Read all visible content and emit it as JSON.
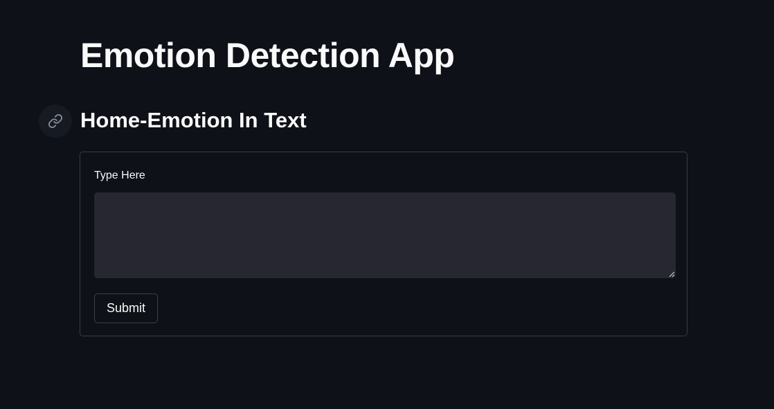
{
  "app": {
    "title": "Emotion Detection App"
  },
  "section": {
    "title": "Home-Emotion In Text",
    "anchor_icon": "link-icon"
  },
  "form": {
    "text_area": {
      "label": "Type Here",
      "value": "",
      "placeholder": ""
    },
    "submit_label": "Submit"
  },
  "colors": {
    "background": "#0e1117",
    "text": "#fafafa",
    "input_background": "#262730",
    "border": "#3a3d45"
  }
}
